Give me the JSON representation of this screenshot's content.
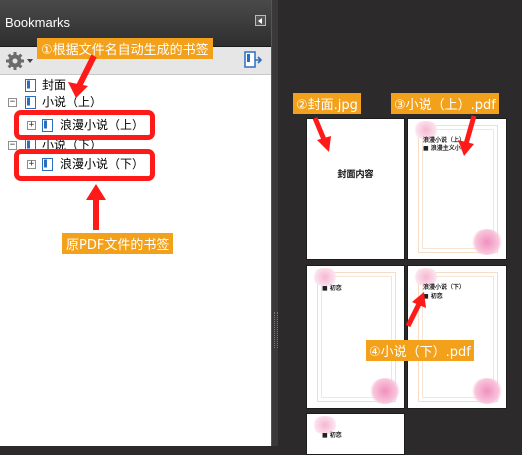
{
  "panel": {
    "title": "Bookmarks",
    "bookmarks": [
      {
        "label": "封面",
        "level": 1,
        "expander": ""
      },
      {
        "label": "小说（上）",
        "level": 0,
        "expander": "−"
      },
      {
        "label": "浪漫小说（上）",
        "level": 1,
        "expander": "+"
      },
      {
        "label": "小说（下）",
        "level": 0,
        "expander": "−"
      },
      {
        "label": "浪漫小说（下）",
        "level": 1,
        "expander": "+"
      }
    ]
  },
  "annotations": {
    "auto_generated": "①根据文件名自动生成的书签",
    "original_pdf": "原PDF文件的书签",
    "cover_jpg": "②封面.jpg",
    "novel_upper_pdf": "③小说（上）.pdf",
    "novel_lower_pdf": "④小说（下）.pdf"
  },
  "thumbnails": {
    "cover_text": "封面内容",
    "page2_title": "浪漫小说（上）",
    "page2_sub": "■ 浪漫主义小说",
    "page3_sub": "■ 初恋",
    "page4_title": "浪漫小说（下）",
    "page4_sub": "■ 初恋",
    "page5_sub": "■ 初恋"
  },
  "colors": {
    "highlight": "#ff1a1a",
    "annotation_bg": "#f3a11a",
    "bookmark_icon": "#2a6fbf"
  }
}
